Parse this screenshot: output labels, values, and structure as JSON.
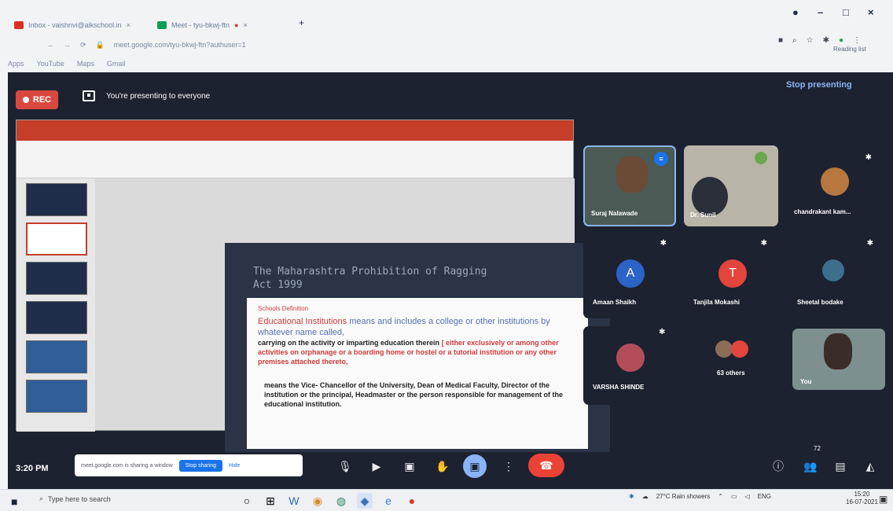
{
  "browser": {
    "tabs": [
      {
        "label": "Inbox - vaishnvi@aikschool.in",
        "color": "#d93025"
      },
      {
        "label": "Meet - tyu-bkwj-ftn",
        "color": "#0f9d58"
      }
    ],
    "new_tab": "+",
    "address": "meet.google.com/tyu-bkwj-ftn?authuser=1",
    "bookmarks": [
      "Apps",
      "YouTube",
      "Maps",
      "Gmail"
    ],
    "reading_list": "Reading list",
    "window_controls": [
      "–",
      "□",
      "×"
    ]
  },
  "meet": {
    "rec_label": "REC",
    "presenting_text": "You're presenting to everyone",
    "stop_presenting": "Stop presenting",
    "clock": "3:20 PM",
    "share_notice": "meet.google.com is sharing a window",
    "stop_sharing": "Stop sharing",
    "hide": "Hide",
    "people_count": "72",
    "participants": [
      {
        "name": "Suraj Nalawade",
        "type": "video"
      },
      {
        "name": "Dr. Sunil",
        "type": "video"
      },
      {
        "name": "chandrakant kam...",
        "type": "photo"
      },
      {
        "name": "Amaan Shaikh",
        "initial": "A",
        "color": "#2b63c6"
      },
      {
        "name": "Tanjila Mokashi",
        "initial": "T",
        "color": "#e2453c"
      },
      {
        "name": "Sheetal bodake",
        "type": "photo"
      },
      {
        "name": "VARSHA SHINDE",
        "type": "photo"
      },
      {
        "name": "63 others",
        "type": "group"
      },
      {
        "name": "You",
        "type": "video"
      }
    ]
  },
  "slide": {
    "title_line1": "The Maharashtra Prohibition of Ragging",
    "title_line2": "Act 1999",
    "heading": "Schools Definition",
    "p1_red": "Educational Institutions",
    "p1_blue": "means and includes a college or other institutions by whatever name called,",
    "p1_dark": "carrying on the activity or imparting education therein",
    "p1_red2": "[ either exclusively or among other activities",
    "p1_red3": "on orphanage or a boarding home or hostel or a tutorial institution or any other premises attached thereto,",
    "p2": "means the Vice- Chancellor of the University, Dean of Medical Faculty, Director of the institution or the principal, Headmaster or the person responsible for management of the educational institution."
  },
  "taskbar": {
    "search_placeholder": "Type here to search",
    "weather": "27°C Rain showers",
    "lang": "ENG",
    "time": "15:20",
    "date": "16-07-2021"
  }
}
